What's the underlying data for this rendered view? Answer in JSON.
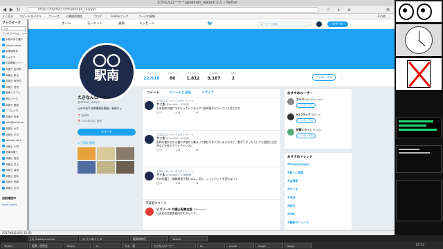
{
  "window": {
    "title": "えきなんローヤー(@ekinan_lawyer)さん | Twitter"
  },
  "browser": {
    "url": "https://twitter.com/ekinan_lawyer",
    "bookmarks": [
      "よく見る",
      "スピードダイヤル",
      "ニュース",
      "公開検索雑誌",
      "ブログ",
      "Firefoxブック",
      "ページの情報",
      "その他"
    ]
  },
  "sidebar": {
    "title": "ブックマーク",
    "search_placeholder": "検索",
    "section": "ブックマークメニュー",
    "items": [
      "手紙の歩き通り",
      "tabuki.hipaa",
      "医療論争系",
      "ヤキサワ",
      "内容確認ツイー",
      "弁護士 吉村郎",
      "弁護士 新太",
      "弁護士 坂田泊",
      "弁護士 島田",
      "医療トラブル",
      "青空ユーロ",
      "弁護士 菅原",
      "ニコムメモ",
      "弁護士 鈴木",
      "yuki@bankrup",
      "弁護士 大井",
      "弁護士 中川",
      "twinate.ultra",
      "弁護士 小林",
      "射撃弁護士",
      "弁護士 島田",
      "弁護士 井上",
      "弁護士 高田",
      "弁護士 田中",
      "弁護士 伊藤",
      "弁護士 中村"
    ],
    "footer_title": "自前確保中",
    "footer_link": "https://twitt"
  },
  "twitter": {
    "nav": {
      "home": "ホーム",
      "moments": "モーメント",
      "notifications": "通知",
      "messages": "メッセージ",
      "search_placeholder": "キーワード検索",
      "tweet_button": "ツイート"
    },
    "stats": [
      {
        "label": "ツイート",
        "value": "22,618"
      },
      {
        "label": "フォロー",
        "value": "86"
      },
      {
        "label": "フォロワー",
        "value": "1,812"
      },
      {
        "label": "いいね",
        "value": "9,167"
      },
      {
        "label": "リスト",
        "value": "2"
      }
    ],
    "follow_button": "フォローする",
    "avatar_text_top": "〇〇",
    "avatar_text_bottom": "駅南",
    "profile": {
      "name": "えきなんローヤー",
      "handle": "@ekinan_lawyer",
      "bio": "元IEの若手法律事務所勤務。新規チェ",
      "location": "医療界",
      "joined": "2010年8月に登録",
      "tweet_button": "ツイート",
      "media_label": "27 写真と動画"
    },
    "tabs": [
      "ツイート",
      "ツイートと返信",
      "メディア"
    ],
    "tweets": [
      {
        "rt": "えきなんローヤーさんがリツイート",
        "name": "サイ太",
        "handle": "@meetan · 29分前",
        "text": "まあ医師が働けすぎだっていうならクソ医師寝かせよっていう話だかな",
        "actions": [
          "1",
          "8",
          "6"
        ]
      },
      {
        "rt": "えきなんローヤーさんがリツイート",
        "name": "サイ太",
        "handle": "@meetan · 29分前",
        "text": "医師を働かせたら働かす前から集まって就任する人がいるよだけど、数が下がったとしても個別に生活費などを考えてクソチャンスに",
        "actions": [
          "1",
          "8",
          "6"
        ]
      },
      {
        "rt": "えきなんローヤーさんがリツイート",
        "name": "サイ太",
        "handle": "@meetan · 22時間前",
        "text": "市の弁護士、報酬規程が変わるよ。北も、こういうことを国ではって",
        "actions": [
          "1",
          "8",
          "6"
        ]
      }
    ],
    "promo_title": "プロモツイート",
    "promo": {
      "name": "ビズリーチ 弁護士転職支援",
      "handle": "@bizreach",
      "text": "日本初の営業実務向けのキャリア..."
    },
    "who_to_follow": {
      "title": "おすすめユーザー",
      "users": [
        {
          "name": "カルベーい",
          "handle": "@karubee",
          "button": "フォローする"
        },
        {
          "name": "K2ブラック",
          "handle": "@k2_bl",
          "button": "フォローする"
        },
        {
          "name": "後藤とらっく",
          "handle": "@track",
          "button": "フォローする"
        }
      ]
    },
    "trends": {
      "title": "おすすめトレンド",
      "items": [
        "#tomosayapia",
        "#新しい地図",
        "#吉野家",
        "#サイネ",
        "#平成",
        "#新作",
        "#iOS",
        "#最新のニュース"
      ]
    }
  },
  "statusbar": {
    "text": "2017年8月10日 12:45"
  },
  "taskbar": {
    "tasks_top": [
      "[1] 3,ewaysnoHvie",
      "[1] をつめくしの",
      "最高裁判所",
      "Twitter"
    ],
    "tasks_bottom": [
      "Twitter",
      "医療 - 医療会",
      "Twitter",
      "1k",
      "える - 高",
      "えきなんローヤー",
      "bc",
      "acoub",
      "egypt",
      "saigo"
    ],
    "clock": "11:52"
  }
}
